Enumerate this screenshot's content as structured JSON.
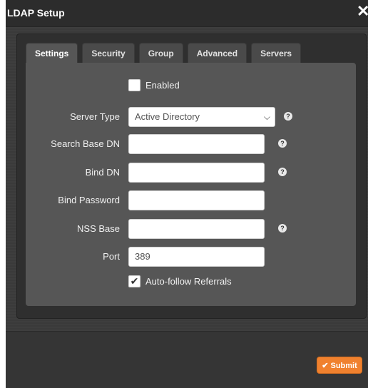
{
  "dialog": {
    "title": "LDAP Setup",
    "close_glyph": "✕"
  },
  "tabs": [
    {
      "label": "Settings",
      "active": true
    },
    {
      "label": "Security",
      "active": false
    },
    {
      "label": "Group",
      "active": false
    },
    {
      "label": "Advanced",
      "active": false
    },
    {
      "label": "Servers",
      "active": false
    }
  ],
  "form": {
    "enabled": {
      "label": "Enabled",
      "checked": false
    },
    "server_type": {
      "label": "Server Type",
      "value": "Active Directory"
    },
    "search_base_dn": {
      "label": "Search Base DN",
      "value": ""
    },
    "bind_dn": {
      "label": "Bind DN",
      "value": ""
    },
    "bind_password": {
      "label": "Bind Password",
      "value": ""
    },
    "nss_base": {
      "label": "NSS Base",
      "value": ""
    },
    "port": {
      "label": "Port",
      "value": "389"
    },
    "auto_follow": {
      "label": "Auto-follow Referrals",
      "checked": true
    }
  },
  "footer": {
    "submit_label": "✔ Submit"
  },
  "colors": {
    "accent": "#f0812e",
    "panel": "#565656",
    "background": "#3b3b3b"
  }
}
